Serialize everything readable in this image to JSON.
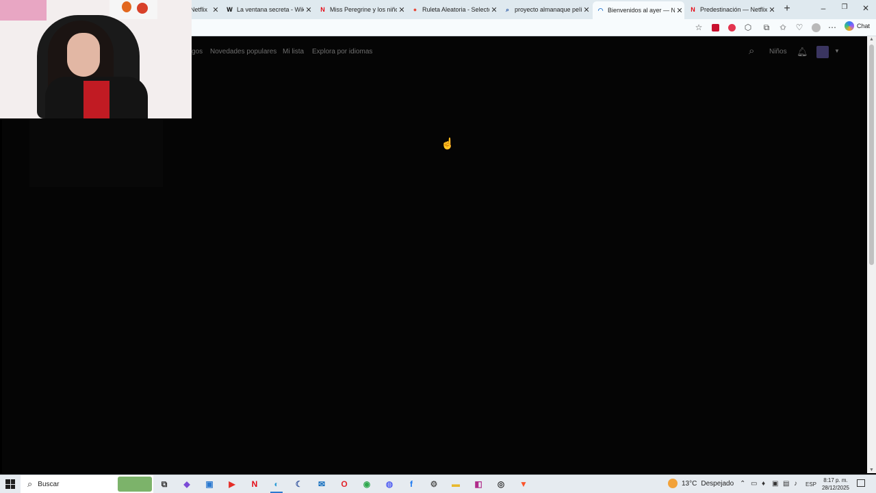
{
  "browser": {
    "tabs": [
      {
        "title": "Netflix",
        "favicon": "N",
        "favicon_color": "#e50914"
      },
      {
        "title": "La ventana secreta - Wikipe",
        "favicon": "W",
        "favicon_color": "#000000"
      },
      {
        "title": "Miss Peregrine y los niños p",
        "favicon": "N",
        "favicon_color": "#e50914"
      },
      {
        "title": "Ruleta Aleatoria - Selector",
        "favicon": "●",
        "favicon_color": "#e64a3b"
      },
      {
        "title": "proyecto almanaque pelícu",
        "favicon": "⌕",
        "favicon_color": "#2b5aa6"
      },
      {
        "title": "Bienvenidos al ayer — Netf",
        "favicon": "◠",
        "favicon_color": "#2b79d0"
      },
      {
        "title": "Predestinación — Netflix",
        "favicon": "N",
        "favicon_color": "#e50914"
      }
    ],
    "active_tab_index": 5,
    "new_tab_symbol": "+",
    "window_controls": {
      "minimize": "–",
      "restore": "❐",
      "close": "✕"
    },
    "toolbar": {
      "chat_label": "Chat"
    }
  },
  "netflix": {
    "nav": {
      "partial_item": "gos",
      "items": [
        "Novedades populares",
        "Mi lista",
        "Explora por idiomas"
      ],
      "kids_label": "Niños"
    }
  },
  "taskbar": {
    "search_placeholder": "Buscar",
    "weather": {
      "temp": "13°C",
      "condition": "Despejado"
    },
    "language": "ESP",
    "time": "8:17 p. m.",
    "date": "28/12/2025"
  },
  "colors": {
    "netflix_red": "#e50914",
    "accent": "#2b79d0"
  }
}
